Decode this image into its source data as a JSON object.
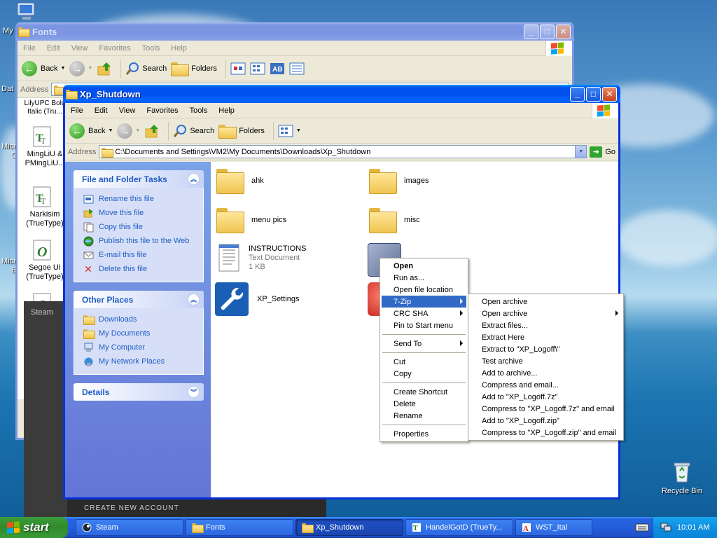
{
  "desktop": {
    "labels": [
      "My",
      "Dat",
      "Micro",
      "C",
      "Micro",
      "B"
    ],
    "recycle_bin": "Recycle Bin"
  },
  "fonts_window": {
    "title": "Fonts",
    "menu": [
      "File",
      "Edit",
      "View",
      "Favorites",
      "Tools",
      "Help"
    ],
    "back": "Back",
    "search": "Search",
    "folders": "Folders",
    "address_label": "Address",
    "font_items": [
      {
        "name": "LilyUPC Bold Italic (Tru..."
      },
      {
        "name": "MingLiU & PMingLiU..."
      },
      {
        "name": "Narkisim (TrueType)"
      },
      {
        "name": "Segoe UI (TrueType)"
      }
    ]
  },
  "steam_window": {
    "title": "Steam",
    "footer": "CREATE NEW ACCOUNT"
  },
  "main_window": {
    "title": "Xp_Shutdown",
    "menu": [
      "File",
      "Edit",
      "View",
      "Favorites",
      "Tools",
      "Help"
    ],
    "back": "Back",
    "search": "Search",
    "folders": "Folders",
    "address_label": "Address",
    "address_value": "C:\\Documents and Settings\\VM2\\My Documents\\Downloads\\Xp_Shutdown",
    "go": "Go",
    "file_tasks": {
      "header": "File and Folder Tasks",
      "items": [
        "Rename this file",
        "Move this file",
        "Copy this file",
        "Publish this file to the Web",
        "E-mail this file",
        "Delete this file"
      ]
    },
    "other_places": {
      "header": "Other Places",
      "items": [
        "Downloads",
        "My Documents",
        "My Computer",
        "My Network Places"
      ]
    },
    "details": {
      "header": "Details"
    },
    "files": [
      {
        "name": "ahk"
      },
      {
        "name": "images"
      },
      {
        "name": "menu pics"
      },
      {
        "name": "misc"
      },
      {
        "name": "INSTRUCTIONS",
        "type": "Text Document",
        "size": "1 KB"
      },
      {
        "name": "XP_Settings"
      }
    ]
  },
  "context_menu": {
    "items": [
      "Open",
      "Run as...",
      "Open file location",
      "7-Zip",
      "CRC SHA",
      "Pin to Start menu",
      "Send To",
      "Cut",
      "Copy",
      "Create Shortcut",
      "Delete",
      "Rename",
      "Properties"
    ]
  },
  "zip_submenu": {
    "items": [
      "Open archive",
      "Open archive",
      "Extract files...",
      "Extract Here",
      "Extract to \"XP_Logoff\\\"",
      "Test archive",
      "Add to archive...",
      "Compress and email...",
      "Add to \"XP_Logoff.7z\"",
      "Compress to \"XP_Logoff.7z\" and email",
      "Add to \"XP_Logoff.zip\"",
      "Compress to \"XP_Logoff.zip\" and email"
    ]
  },
  "taskbar": {
    "start": "start",
    "items": [
      "Steam",
      "Fonts",
      "Xp_Shutdown",
      "HandelGotD (TrueTy...",
      "WST_Ital"
    ],
    "clock": "10:01 AM"
  },
  "colors": {
    "xp_blue": "#0831d9",
    "menu_highlight": "#316ac5",
    "task_link": "#215dc6"
  }
}
